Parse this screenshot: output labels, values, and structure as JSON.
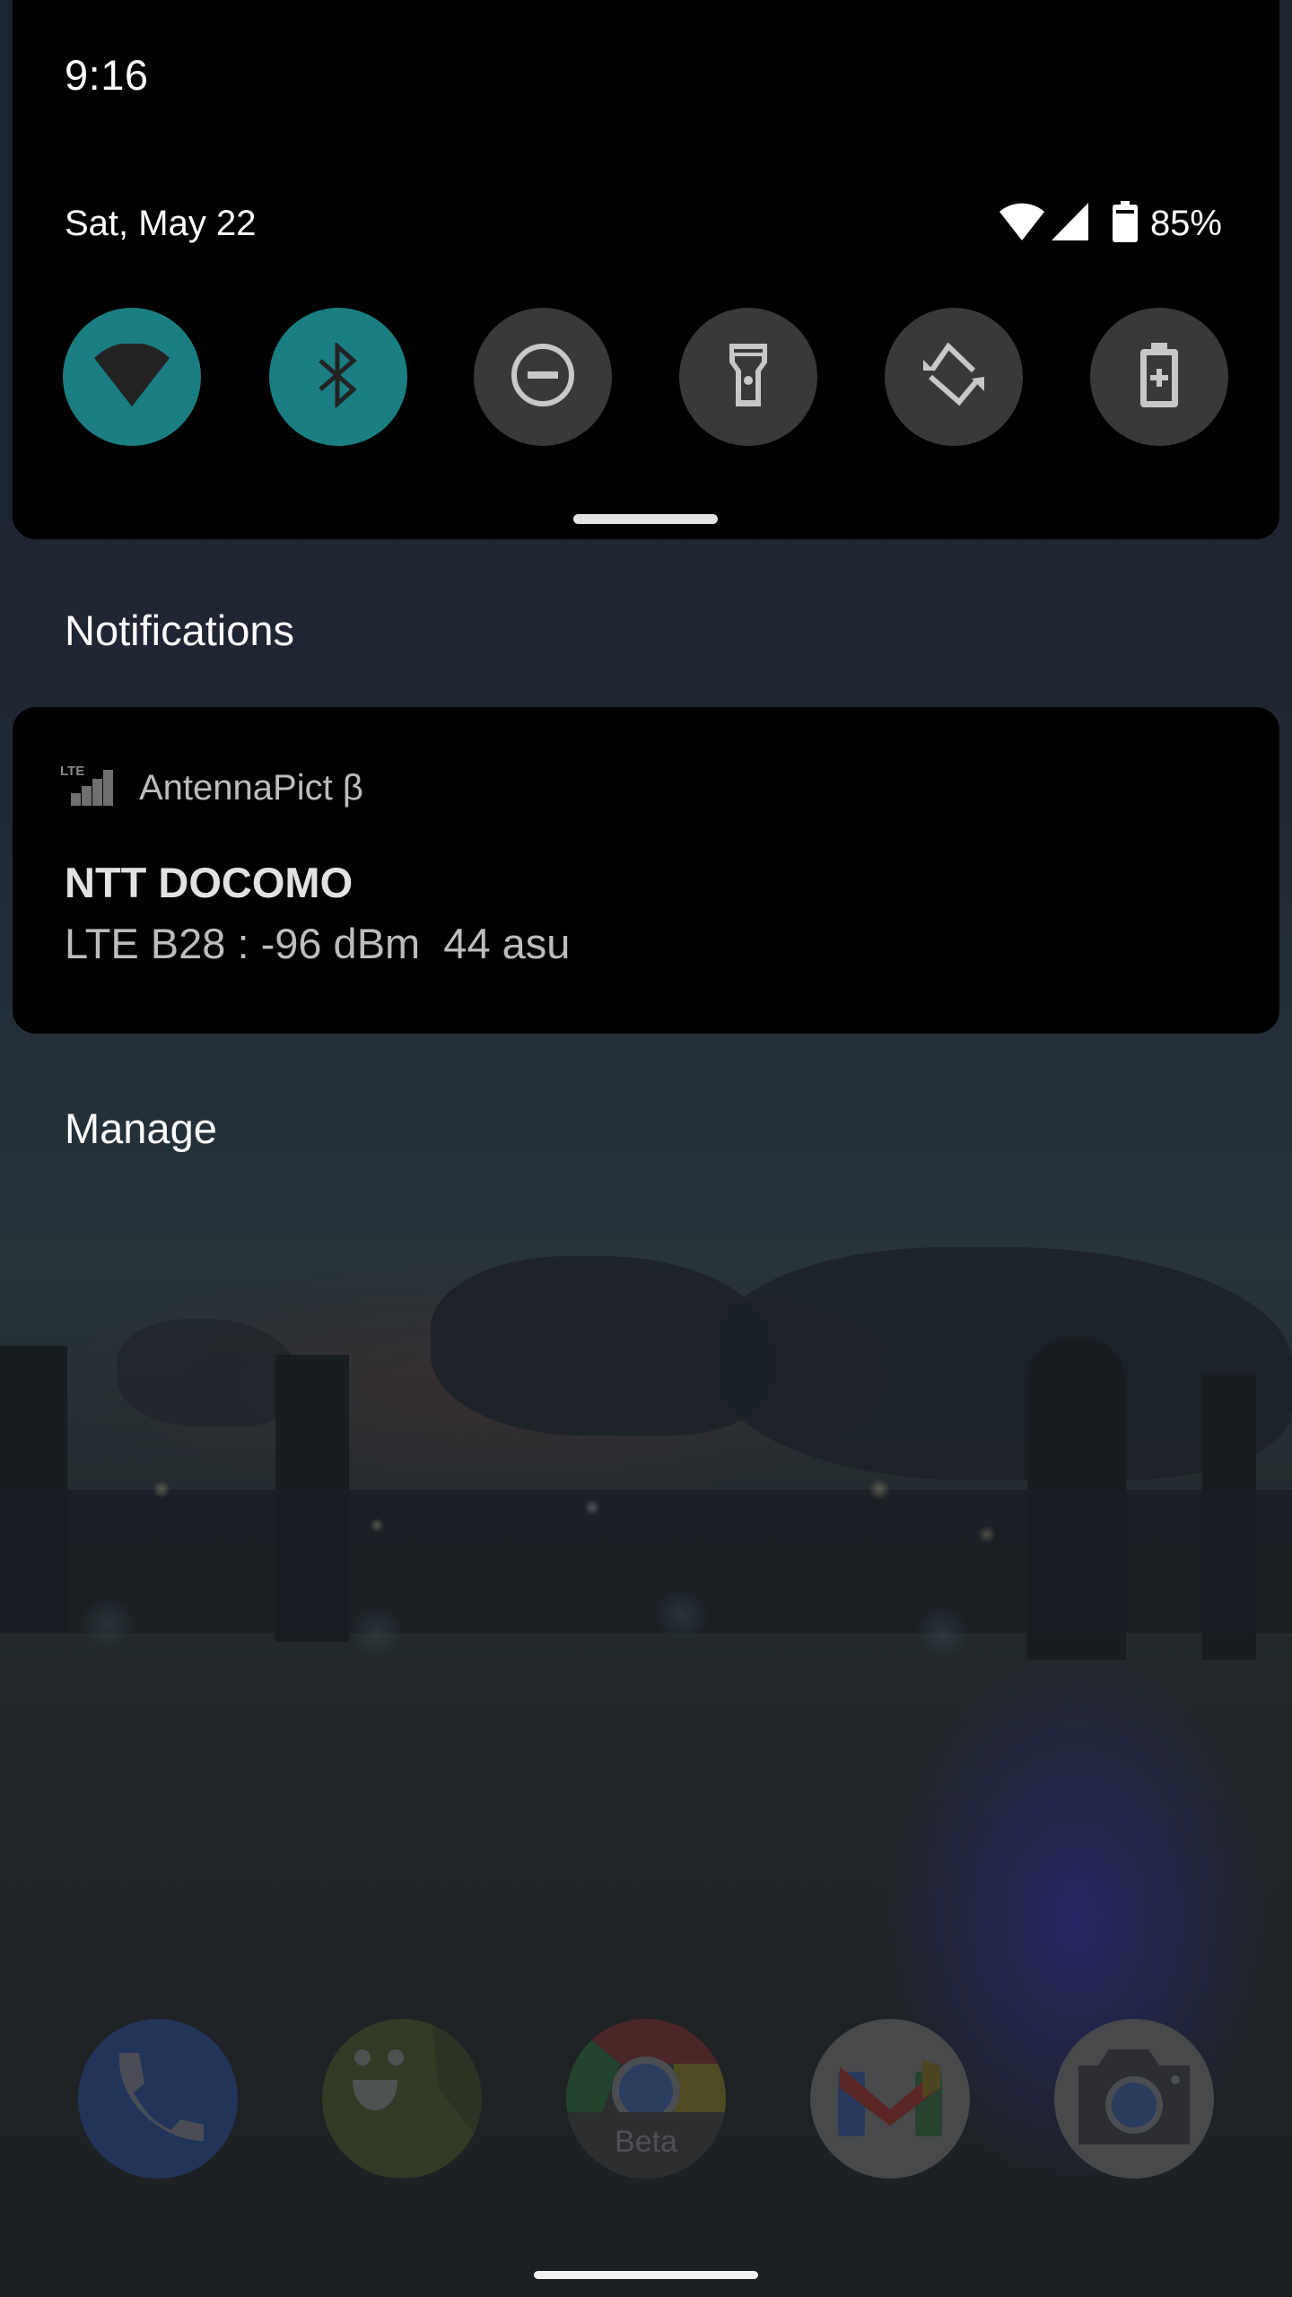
{
  "status": {
    "time": "9:16",
    "date": "Sat, May 22",
    "battery_percent": "85%",
    "icons": [
      "wifi-icon",
      "cellular-signal-icon",
      "battery-icon"
    ]
  },
  "quick_settings": {
    "tiles": [
      {
        "name": "Wi-Fi",
        "icon": "wifi-icon",
        "state": "on"
      },
      {
        "name": "Bluetooth",
        "icon": "bluetooth-icon",
        "state": "on"
      },
      {
        "name": "Do Not Disturb",
        "icon": "do-not-disturb-icon",
        "state": "off"
      },
      {
        "name": "Flashlight",
        "icon": "flashlight-icon",
        "state": "off"
      },
      {
        "name": "Auto-rotate",
        "icon": "rotate-icon",
        "state": "off"
      },
      {
        "name": "Battery Saver",
        "icon": "battery-saver-icon",
        "state": "off"
      }
    ],
    "accent_color": "#1a7e83",
    "inactive_color": "#393939"
  },
  "notifications": {
    "header": "Notifications",
    "items": [
      {
        "app_name": "AntennaPict β",
        "app_icon": "lte-signal-icon",
        "app_icon_label": "LTE",
        "title": "NTT DOCOMO",
        "text": "LTE B28 : -96 dBm  44 asu"
      }
    ],
    "manage_label": "Manage"
  },
  "dock": {
    "apps": [
      {
        "name": "Phone",
        "icon": "phone-icon"
      },
      {
        "name": "Messages",
        "icon": "messages-icon"
      },
      {
        "name": "Chrome Beta",
        "icon": "chrome-beta-icon",
        "badge": "Beta"
      },
      {
        "name": "Gmail",
        "icon": "gmail-icon"
      },
      {
        "name": "Camera",
        "icon": "camera-icon"
      }
    ]
  }
}
